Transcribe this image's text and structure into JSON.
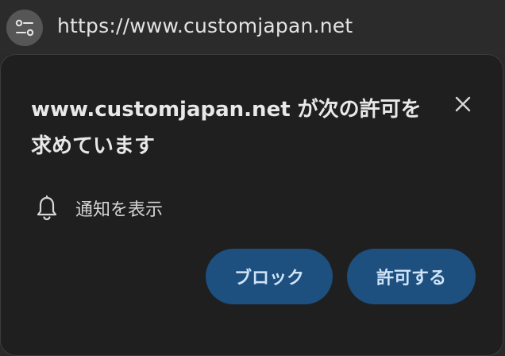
{
  "addressbar": {
    "url": "https://www.customjapan.net",
    "site_info_icon": "tune-icon"
  },
  "popup": {
    "title": "www.customjapan.net が次の許可を求めています",
    "close_icon": "close-icon",
    "permission": {
      "icon": "bell-icon",
      "label": "通知を表示"
    },
    "buttons": {
      "block": "ブロック",
      "allow": "許可する"
    }
  },
  "colors": {
    "popup_bg": "#1f1f1f",
    "button_bg": "#1d4f7f",
    "button_text": "#cfe3f7",
    "text": "#e8e8e8"
  }
}
